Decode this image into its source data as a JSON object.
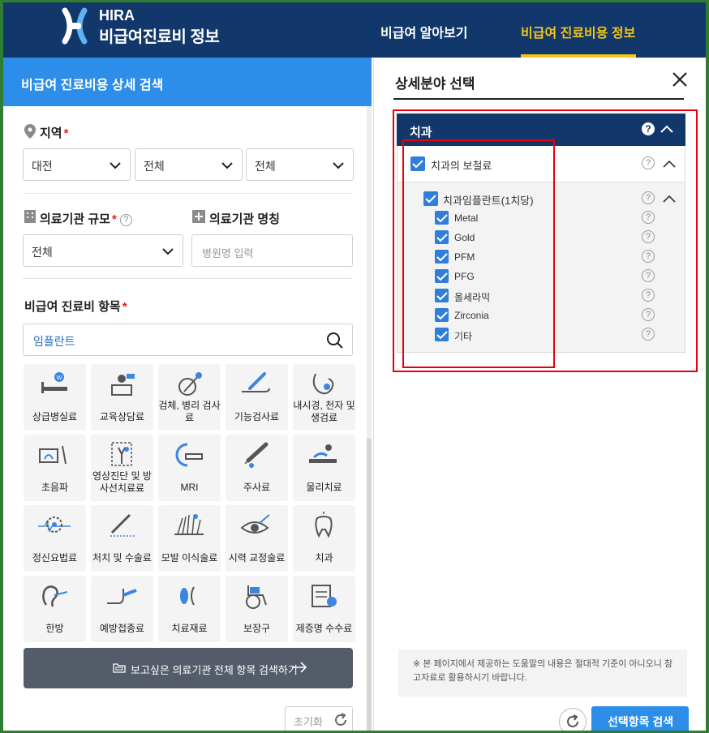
{
  "header": {
    "brand_line1": "HIRA",
    "brand_line2": "비급여진료비 정보",
    "nav": [
      "비급여 알아보기",
      "비급여 진료비용 정보"
    ],
    "active_nav": 1,
    "colors": {
      "navy": "#12386b",
      "accent": "#f5c518"
    }
  },
  "left": {
    "panel_title": "비급여 진료비용 상세 검색",
    "region": {
      "label": "지역",
      "required_mark": "*",
      "selects": [
        "대전",
        "전체",
        "전체"
      ]
    },
    "institution_size": {
      "label": "의료기관 규모",
      "required_mark": "*",
      "help": "?",
      "value": "전체"
    },
    "institution_name": {
      "label": "의료기관 명칭",
      "placeholder": "병원명 입력"
    },
    "items": {
      "label": "비급여 진료비 항목",
      "required_mark": "*",
      "search_value": "임플란트"
    },
    "tiles": [
      {
        "label": "상급병실료",
        "icon": "hospital-bed-icon"
      },
      {
        "label": "교육상담료",
        "icon": "counseling-desk-icon"
      },
      {
        "label": "검체, 병리 검사료",
        "icon": "specimen-test-icon"
      },
      {
        "label": "기능검사료",
        "icon": "arm-thermometer-icon"
      },
      {
        "label": "내시경, 천자 및 생검료",
        "icon": "endoscope-icon"
      },
      {
        "label": "초음파",
        "icon": "ultrasound-icon"
      },
      {
        "label": "영상진단 및 방사선치료료",
        "icon": "x-ray-icon"
      },
      {
        "label": "MRI",
        "icon": "mri-icon"
      },
      {
        "label": "주사료",
        "icon": "syringe-icon"
      },
      {
        "label": "물리치료",
        "icon": "physical-therapy-icon"
      },
      {
        "label": "정신요법료",
        "icon": "brain-wave-icon"
      },
      {
        "label": "처치 및 수술료",
        "icon": "scalpel-icon"
      },
      {
        "label": "모발 이식술료",
        "icon": "hair-transplant-icon"
      },
      {
        "label": "시력 교정술료",
        "icon": "eye-laser-icon"
      },
      {
        "label": "치과",
        "icon": "tooth-icon"
      },
      {
        "label": "한방",
        "icon": "acupuncture-ear-icon"
      },
      {
        "label": "예방접종료",
        "icon": "vaccine-arm-icon"
      },
      {
        "label": "치료재료",
        "icon": "treatment-material-icon"
      },
      {
        "label": "보장구",
        "icon": "wheelchair-icon"
      },
      {
        "label": "제증명 수수료",
        "icon": "certificate-icon"
      }
    ],
    "all_items_button": "보고싶은 의료기관 전체 항목 검색하기",
    "reset_button": "초기화"
  },
  "right": {
    "title": "상세분야 선택",
    "category": {
      "name": "치과",
      "help": "?",
      "group": {
        "label": "치과의 보철료",
        "help": "?",
        "sub_group": {
          "label": "치과임플란트(1치당)",
          "help": "?",
          "options": [
            "Metal",
            "Gold",
            "PFM",
            "PFG",
            "올세라믹",
            "Zirconia",
            "기타"
          ]
        }
      }
    },
    "notice": "※ 본 페이지에서 제공하는 도움말의 내용은 절대적 기준이 아니오니 참고자료로 활용하시기 바랍니다.",
    "search_button": "선택항목 검색",
    "colors": {
      "button_blue": "#2c8ee8",
      "highlight_red": "#e8000b"
    }
  }
}
